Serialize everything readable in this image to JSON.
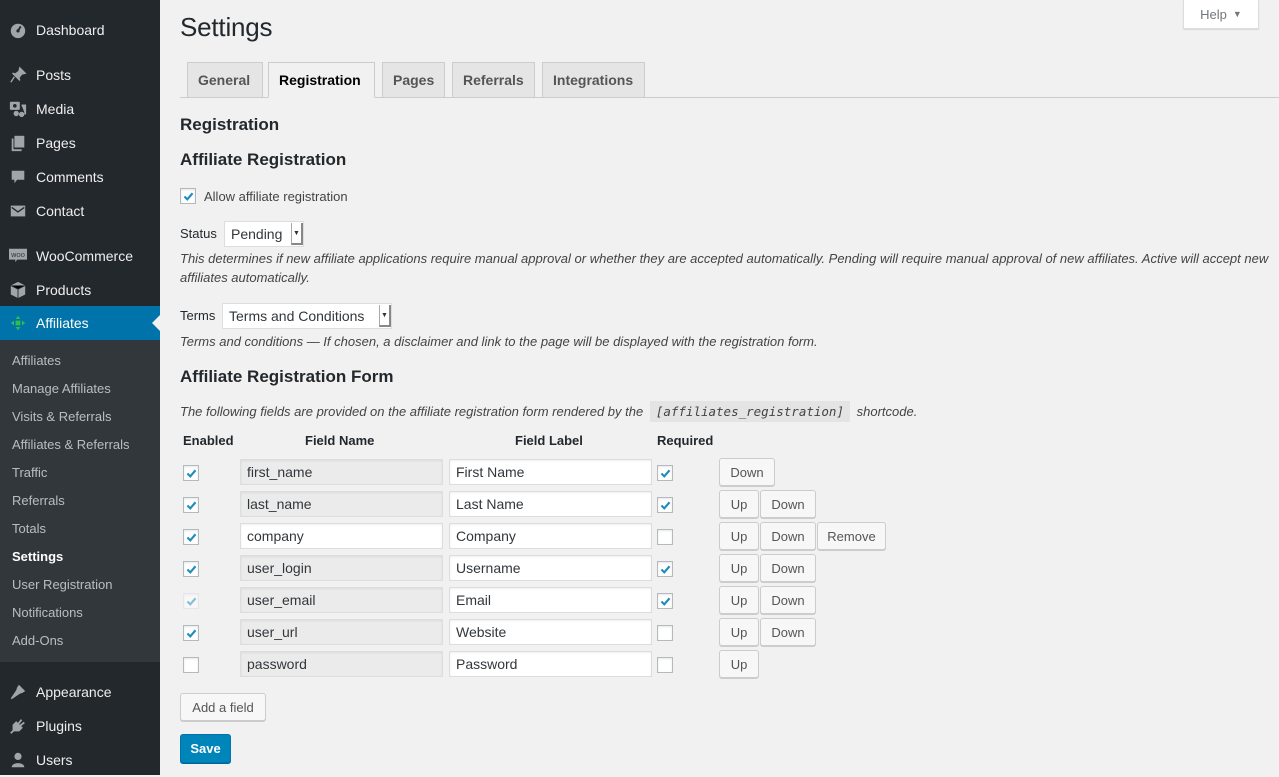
{
  "sidebar": {
    "menu": [
      {
        "label": "Dashboard",
        "icon": "dashboard-icon"
      },
      {
        "label": "Posts",
        "icon": "pin-icon"
      },
      {
        "label": "Media",
        "icon": "media-icon"
      },
      {
        "label": "Pages",
        "icon": "pages-icon"
      },
      {
        "label": "Comments",
        "icon": "comment-icon"
      },
      {
        "label": "Contact",
        "icon": "envelope-icon"
      },
      {
        "label": "WooCommerce",
        "icon": "woo-icon"
      },
      {
        "label": "Products",
        "icon": "box-icon"
      },
      {
        "label": "Affiliates",
        "icon": "affiliates-icon"
      },
      {
        "label": "Appearance",
        "icon": "brush-icon"
      },
      {
        "label": "Plugins",
        "icon": "plug-icon"
      },
      {
        "label": "Users",
        "icon": "user-icon"
      }
    ],
    "submenu": [
      "Affiliates",
      "Manage Affiliates",
      "Visits & Referrals",
      "Affiliates & Referrals",
      "Traffic",
      "Referrals",
      "Totals",
      "Settings",
      "User Registration",
      "Notifications",
      "Add-Ons"
    ],
    "current_submenu": "Settings"
  },
  "header": {
    "title": "Settings",
    "help_label": "Help",
    "tabs": [
      "General",
      "Registration",
      "Pages",
      "Referrals",
      "Integrations"
    ],
    "active_tab": "Registration"
  },
  "registration": {
    "section_title": "Registration",
    "subsection_title": "Affiliate Registration",
    "allow_label": "Allow affiliate registration",
    "allow_checked": true,
    "status_label": "Status",
    "status_value": "Pending",
    "status_desc": "This determines if new affiliate applications require manual approval or whether they are accepted automatically. Pending will require manual approval of new affiliates. Active will accept new affiliates automatically.",
    "terms_label": "Terms",
    "terms_value": "Terms and Conditions",
    "terms_desc": "Terms and conditions — If chosen, a disclaimer and link to the page will be displayed with the registration form."
  },
  "form": {
    "title": "Affiliate Registration Form",
    "desc_before": "The following fields are provided on the affiliate registration form rendered by the",
    "shortcode": "[affiliates_registration]",
    "desc_after": "shortcode.",
    "columns": [
      "Enabled",
      "Field Name",
      "Field Label",
      "Required"
    ],
    "rows": [
      {
        "enabled": true,
        "enabled_disabled": false,
        "name": "first_name",
        "name_readonly": true,
        "label": "First Name",
        "required": true,
        "buttons": [
          "Down"
        ]
      },
      {
        "enabled": true,
        "enabled_disabled": false,
        "name": "last_name",
        "name_readonly": true,
        "label": "Last Name",
        "required": true,
        "buttons": [
          "Up",
          "Down"
        ]
      },
      {
        "enabled": true,
        "enabled_disabled": false,
        "name": "company",
        "name_readonly": false,
        "label": "Company",
        "required": false,
        "buttons": [
          "Up",
          "Down",
          "Remove"
        ]
      },
      {
        "enabled": true,
        "enabled_disabled": false,
        "name": "user_login",
        "name_readonly": true,
        "label": "Username",
        "required": true,
        "buttons": [
          "Up",
          "Down"
        ]
      },
      {
        "enabled": true,
        "enabled_disabled": true,
        "name": "user_email",
        "name_readonly": true,
        "label": "Email",
        "required": true,
        "buttons": [
          "Up",
          "Down"
        ]
      },
      {
        "enabled": true,
        "enabled_disabled": false,
        "name": "user_url",
        "name_readonly": true,
        "label": "Website",
        "required": false,
        "buttons": [
          "Up",
          "Down"
        ]
      },
      {
        "enabled": false,
        "enabled_disabled": false,
        "name": "password",
        "name_readonly": true,
        "label": "Password",
        "required": false,
        "buttons": [
          "Up"
        ]
      }
    ],
    "add_field_label": "Add a field",
    "save_label": "Save"
  },
  "colors": {
    "accent": "#0073aa",
    "sidebar_bg": "#23282d",
    "submenu_bg": "#32373c",
    "check": "#1e8cbe",
    "save_bg": "#0085ba"
  }
}
